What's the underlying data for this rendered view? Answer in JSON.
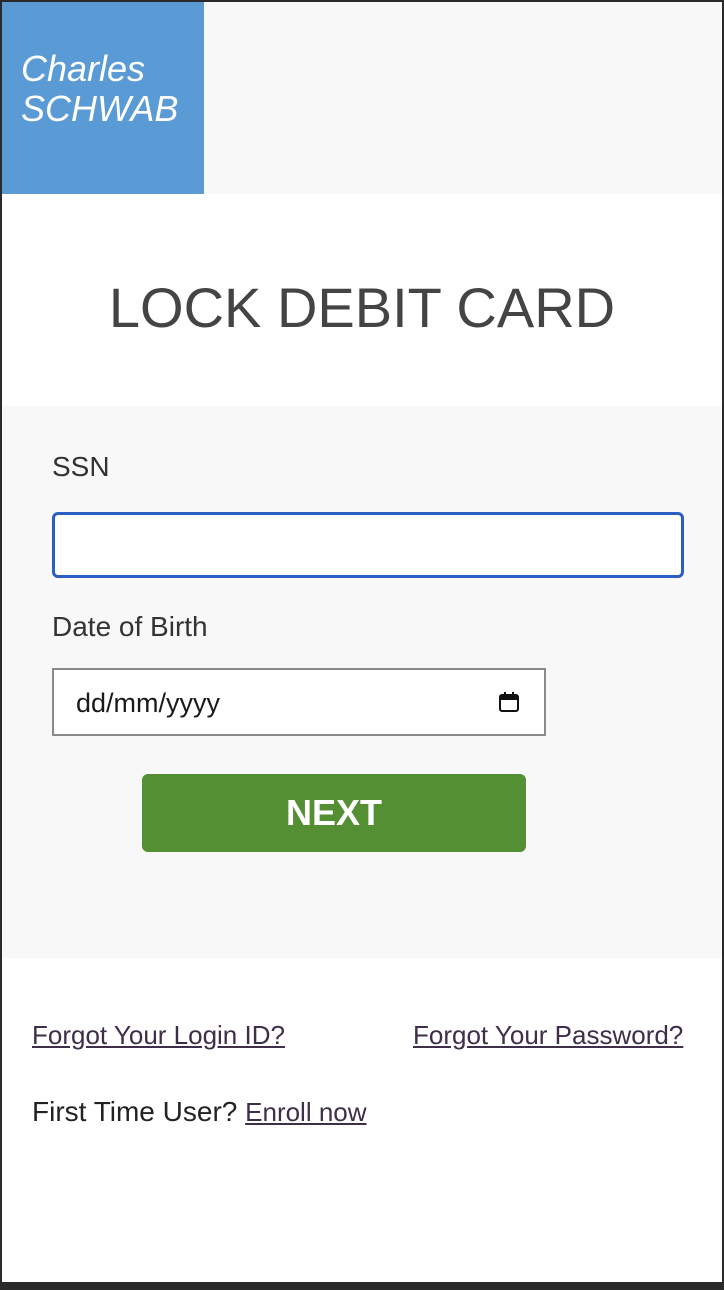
{
  "brand": {
    "line1": "Charles",
    "line2": "SCHWAB",
    "color": "#5b9bd5"
  },
  "page": {
    "title": "LOCK DEBIT CARD"
  },
  "form": {
    "ssn_label": "SSN",
    "ssn_value": "",
    "dob_label": "Date of Birth",
    "dob_placeholder": "dd/mm/yyyy",
    "dob_icon": "calendar-icon",
    "next_label": "NEXT",
    "next_color": "#558f33"
  },
  "links": {
    "forgot_login": "Forgot Your Login ID?",
    "forgot_password": "Forgot Your Password?",
    "first_time_text": "First Time User?",
    "enroll": "Enroll now"
  }
}
